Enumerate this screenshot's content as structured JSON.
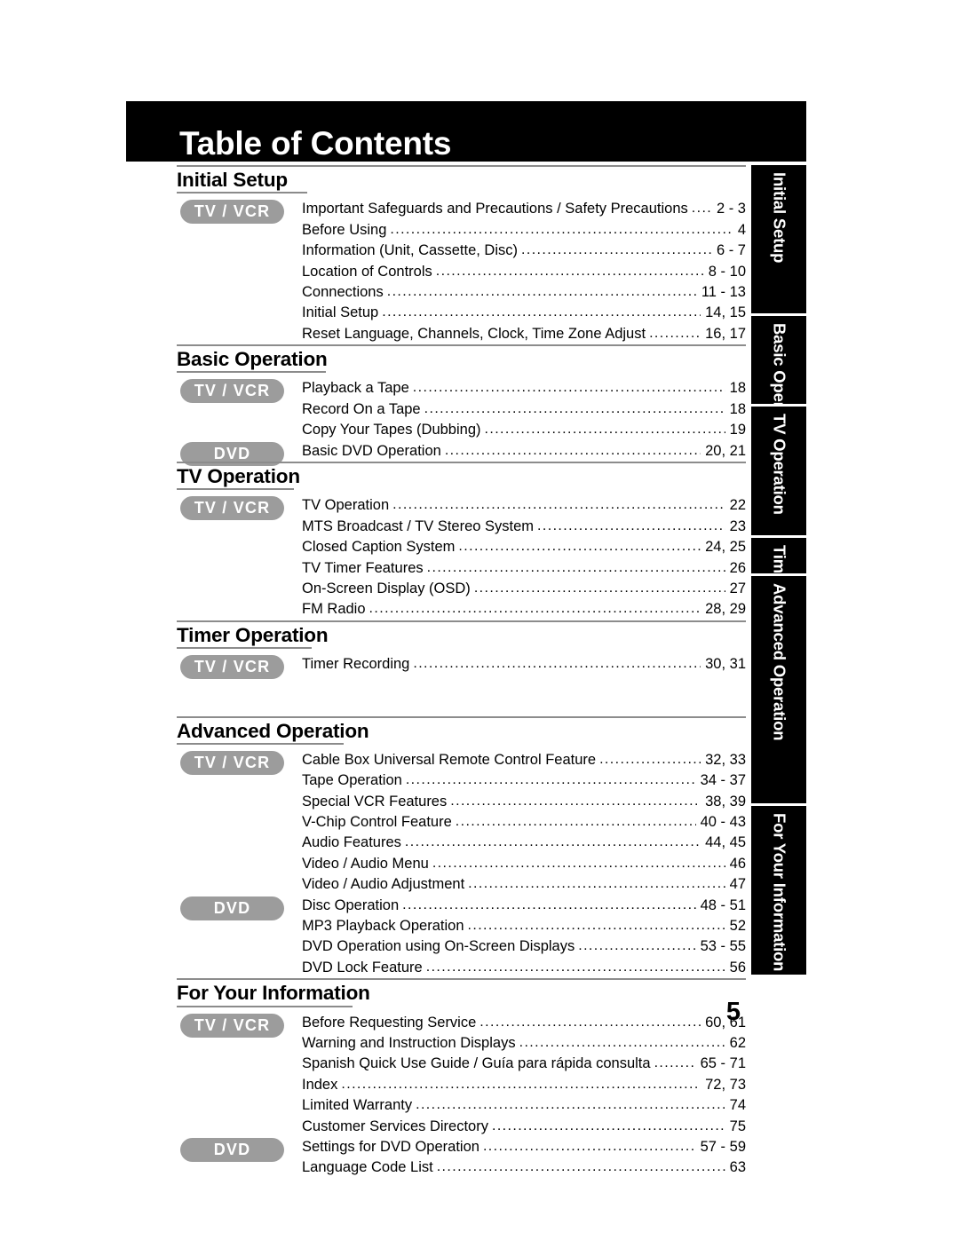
{
  "page": {
    "title": "Table of Contents",
    "page_number": "5",
    "colors": {
      "title_bar_bg": "#000000",
      "title_bar_fg": "#ffffff",
      "badge_bg": "#9c9c9c",
      "badge_fg": "#ffffff",
      "rule": "#8c8c8c",
      "tab_bg": "#000000",
      "tab_fg": "#ffffff",
      "text": "#000000"
    },
    "leader_char": "."
  },
  "sections": [
    {
      "heading": "Initial Setup",
      "tab_label": "Initial Setup",
      "groups": [
        {
          "badge": "TV / VCR",
          "entries": [
            {
              "title": "Important Safeguards and Precautions / Safety Precautions",
              "pages": "2 - 3"
            },
            {
              "title": "Before Using",
              "pages": "4"
            },
            {
              "title": "Information (Unit, Cassette, Disc)",
              "pages": "6 - 7"
            },
            {
              "title": "Location of Controls",
              "pages": "8 - 10"
            },
            {
              "title": "Connections",
              "pages": "11 - 13"
            },
            {
              "title": "Initial Setup",
              "pages": "14, 15"
            },
            {
              "title": "Reset Language, Channels, Clock, Time Zone Adjust",
              "pages": "16, 17"
            }
          ]
        }
      ]
    },
    {
      "heading": "Basic Operation",
      "tab_label": "Basic Operation",
      "groups": [
        {
          "badge": "TV / VCR",
          "entries": [
            {
              "title": "Playback a Tape",
              "pages": "18"
            },
            {
              "title": "Record On a Tape",
              "pages": "18"
            },
            {
              "title": "Copy Your Tapes (Dubbing)",
              "pages": "19"
            }
          ]
        },
        {
          "badge": "DVD",
          "entries": [
            {
              "title": "Basic DVD Operation",
              "pages": "20, 21"
            }
          ]
        }
      ]
    },
    {
      "heading": "TV Operation",
      "tab_label": "TV Operation",
      "groups": [
        {
          "badge": "TV / VCR",
          "entries": [
            {
              "title": "TV Operation",
              "pages": "22"
            },
            {
              "title": "MTS Broadcast / TV Stereo System",
              "pages": "23"
            },
            {
              "title": "Closed Caption System",
              "pages": "24, 25"
            },
            {
              "title": "TV Timer Features",
              "pages": "26"
            },
            {
              "title": "On-Screen Display (OSD)",
              "pages": "27"
            },
            {
              "title": "FM Radio",
              "pages": "28, 29"
            }
          ]
        }
      ]
    },
    {
      "heading": "Timer Operation",
      "tab_label": "Timer Operation",
      "groups": [
        {
          "badge": "TV / VCR",
          "entries": [
            {
              "title": "Timer Recording",
              "pages": "30, 31"
            }
          ]
        }
      ]
    },
    {
      "heading": "Advanced Operation",
      "tab_label": "Advanced Operation",
      "groups": [
        {
          "badge": "TV / VCR",
          "entries": [
            {
              "title": "Cable Box Universal Remote Control Feature",
              "pages": "32, 33"
            },
            {
              "title": "Tape Operation",
              "pages": "34 - 37"
            },
            {
              "title": "Special VCR Features",
              "pages": "38, 39"
            },
            {
              "title": "V-Chip Control Feature",
              "pages": "40 - 43"
            },
            {
              "title": "Audio Features",
              "pages": "44, 45"
            },
            {
              "title": "Video / Audio Menu",
              "pages": "46"
            },
            {
              "title": "Video / Audio Adjustment",
              "pages": "47"
            }
          ]
        },
        {
          "badge": "DVD",
          "entries": [
            {
              "title": "Disc Operation",
              "pages": "48 - 51"
            },
            {
              "title": "MP3 Playback Operation",
              "pages": "52"
            },
            {
              "title": "DVD Operation using On-Screen Displays",
              "pages": "53 - 55"
            },
            {
              "title": "DVD Lock Feature",
              "pages": "56"
            }
          ]
        }
      ]
    },
    {
      "heading": "For Your Information",
      "tab_label": "For Your Information",
      "groups": [
        {
          "badge": "TV / VCR",
          "entries": [
            {
              "title": "Before Requesting Service",
              "pages": "60, 61"
            },
            {
              "title": "Warning and Instruction Displays",
              "pages": "62"
            },
            {
              "title": "Spanish Quick Use Guide / Guía para rápida consulta",
              "pages": "65 - 71"
            },
            {
              "title": "Index",
              "pages": "72, 73"
            },
            {
              "title": "Limited Warranty",
              "pages": "74"
            },
            {
              "title": "Customer Services Directory",
              "pages": "75"
            }
          ]
        },
        {
          "badge": "DVD",
          "entries": [
            {
              "title": "Settings for DVD Operation",
              "pages": "57 - 59"
            },
            {
              "title": "Language Code List",
              "pages": "63"
            }
          ]
        }
      ]
    }
  ]
}
